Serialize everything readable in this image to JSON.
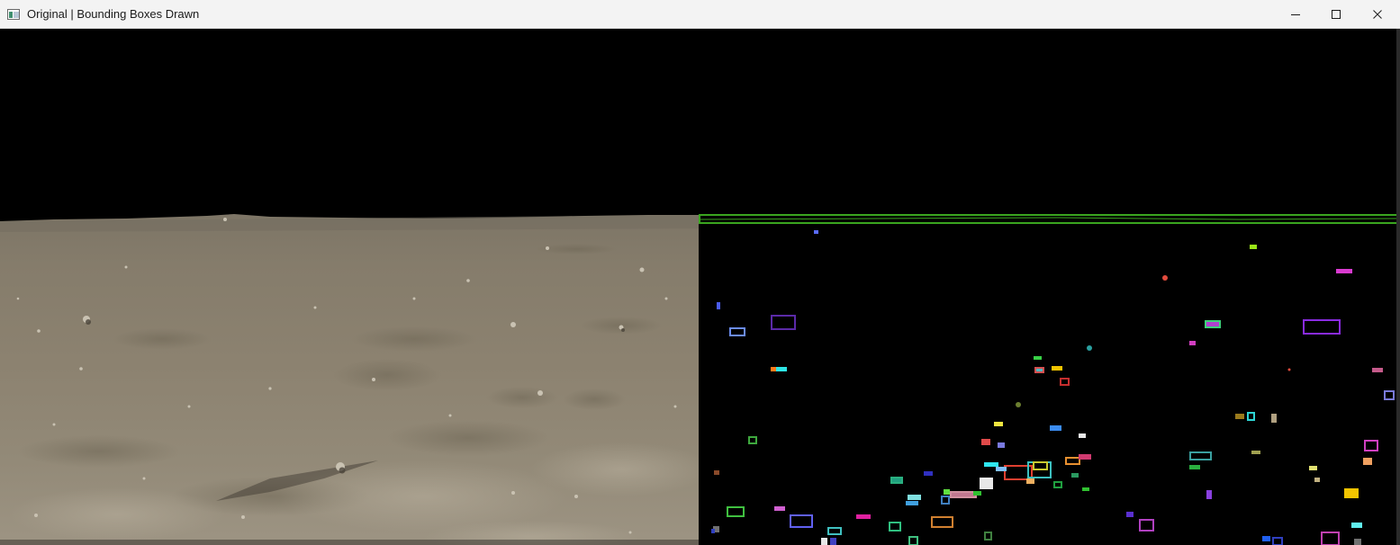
{
  "window": {
    "title": "Original | Bounding Boxes Drawn",
    "controls": {
      "minimize_icon": "minimize-icon",
      "maximize_icon": "maximize-icon",
      "close_icon": "close-icon"
    }
  },
  "panels": {
    "left": {
      "content": "lunar-surface-photo"
    },
    "right": {
      "content": "bounding-box-mask"
    }
  },
  "colors": {
    "titlebar_bg": "#f3f3f3",
    "sky": "#000000",
    "regolith": "#8a7f6c",
    "horizon_box": "#3aa51f"
  }
}
